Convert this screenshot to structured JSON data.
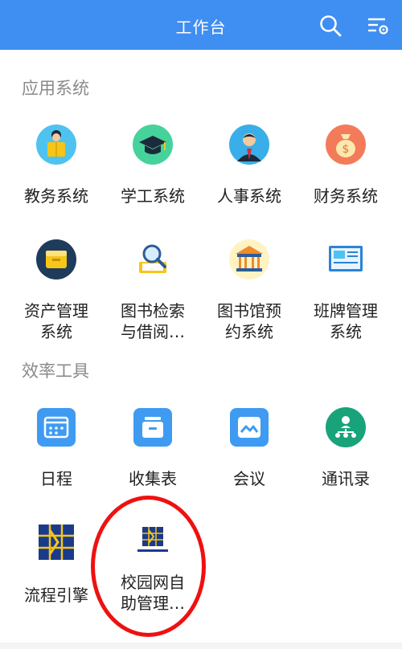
{
  "header": {
    "title": "工作台",
    "search_icon": "search-icon",
    "settings_icon": "list-settings-icon",
    "bg": "#3f8ef2"
  },
  "sections": [
    {
      "title": "应用系统",
      "items": [
        {
          "label": "教务系统",
          "icon": "student-reading-icon"
        },
        {
          "label": "学工系统",
          "icon": "graduation-cap-icon"
        },
        {
          "label": "人事系统",
          "icon": "businessman-icon"
        },
        {
          "label": "财务系统",
          "icon": "money-bag-icon"
        },
        {
          "label": "资产管理系统",
          "line1": "资产管理",
          "line2": "系统",
          "icon": "storage-box-icon"
        },
        {
          "label": "图书检索与借阅",
          "line1": "图书检索",
          "line2": "与借阅…",
          "icon": "magnifier-book-icon"
        },
        {
          "label": "图书馆预约系统",
          "line1": "图书馆预",
          "line2": "约系统",
          "icon": "library-building-icon"
        },
        {
          "label": "班牌管理系统",
          "line1": "班牌管理",
          "line2": "系统",
          "icon": "class-board-icon"
        }
      ]
    },
    {
      "title": "效率工具",
      "items": [
        {
          "label": "日程",
          "icon": "calendar-icon"
        },
        {
          "label": "收集表",
          "icon": "form-stack-icon"
        },
        {
          "label": "会议",
          "icon": "meeting-icon"
        },
        {
          "label": "通讯录",
          "icon": "org-chart-icon"
        },
        {
          "label": "流程引擎",
          "icon": "flow-engine-logo-icon"
        },
        {
          "label": "校园网自助管理",
          "line1": "校园网自",
          "line2": "助管理…",
          "icon": "campus-network-logo-icon"
        }
      ]
    }
  ],
  "colors": {
    "accent_blue": "#3f8ef2",
    "highlight_ring": "#ee1111"
  }
}
